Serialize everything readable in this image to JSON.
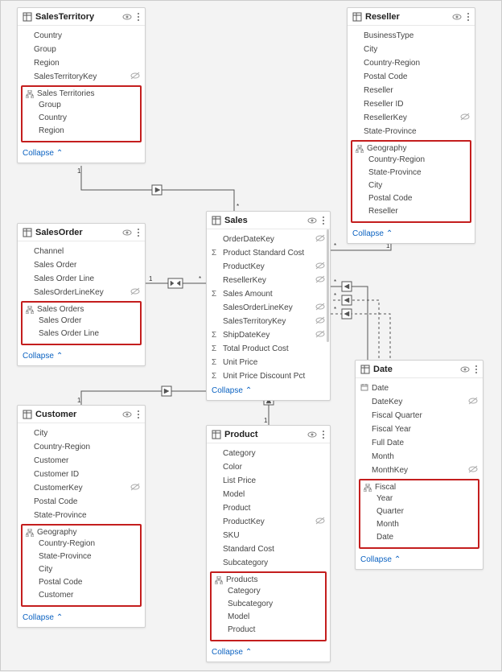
{
  "tables": {
    "salesTerritory": {
      "title": "SalesTerritory",
      "fields": [
        "Country",
        "Group",
        "Region",
        "SalesTerritoryKey"
      ],
      "fieldsHidden": [
        false,
        false,
        false,
        true
      ],
      "hierarchy": {
        "name": "Sales Territories",
        "items": [
          "Group",
          "Country",
          "Region"
        ]
      },
      "collapse": "Collapse"
    },
    "reseller": {
      "title": "Reseller",
      "fields": [
        "BusinessType",
        "City",
        "Country-Region",
        "Postal Code",
        "Reseller",
        "Reseller ID",
        "ResellerKey",
        "State-Province"
      ],
      "fieldsHidden": [
        false,
        false,
        false,
        false,
        false,
        false,
        true,
        false
      ],
      "hierarchy": {
        "name": "Geography",
        "items": [
          "Country-Region",
          "State-Province",
          "City",
          "Postal Code",
          "Reseller"
        ]
      },
      "collapse": "Collapse"
    },
    "salesOrder": {
      "title": "SalesOrder",
      "fields": [
        "Channel",
        "Sales Order",
        "Sales Order Line",
        "SalesOrderLineKey"
      ],
      "fieldsHidden": [
        false,
        false,
        false,
        true
      ],
      "hierarchy": {
        "name": "Sales Orders",
        "items": [
          "Sales Order",
          "Sales Order Line"
        ]
      },
      "collapse": "Collapse"
    },
    "sales": {
      "title": "Sales",
      "fields": [
        "OrderDateKey",
        "Product Standard Cost",
        "ProductKey",
        "ResellerKey",
        "Sales Amount",
        "SalesOrderLineKey",
        "SalesTerritoryKey",
        "ShipDateKey",
        "Total Product Cost",
        "Unit Price",
        "Unit Price Discount Pct"
      ],
      "fieldsIcon": [
        "",
        "sigma",
        "",
        "",
        "sigma",
        "",
        "",
        "sigma",
        "sigma",
        "sigma",
        "sigma"
      ],
      "fieldsHidden": [
        true,
        false,
        true,
        true,
        false,
        true,
        true,
        true,
        false,
        false,
        false
      ],
      "collapse": "Collapse"
    },
    "customer": {
      "title": "Customer",
      "fields": [
        "City",
        "Country-Region",
        "Customer",
        "Customer ID",
        "CustomerKey",
        "Postal Code",
        "State-Province"
      ],
      "fieldsHidden": [
        false,
        false,
        false,
        false,
        true,
        false,
        false
      ],
      "hierarchy": {
        "name": "Geography",
        "items": [
          "Country-Region",
          "State-Province",
          "City",
          "Postal Code",
          "Customer"
        ]
      },
      "collapse": "Collapse"
    },
    "product": {
      "title": "Product",
      "fields": [
        "Category",
        "Color",
        "List Price",
        "Model",
        "Product",
        "ProductKey",
        "SKU",
        "Standard Cost",
        "Subcategory"
      ],
      "fieldsHidden": [
        false,
        false,
        false,
        false,
        false,
        true,
        false,
        false,
        false
      ],
      "hierarchy": {
        "name": "Products",
        "items": [
          "Category",
          "Subcategory",
          "Model",
          "Product"
        ]
      },
      "collapse": "Collapse"
    },
    "date": {
      "title": "Date",
      "fields": [
        "Date",
        "DateKey",
        "Fiscal Quarter",
        "Fiscal Year",
        "Full Date",
        "Month",
        "MonthKey"
      ],
      "fieldsIcon": [
        "cal",
        "",
        "",
        "",
        "",
        "",
        ""
      ],
      "fieldsHidden": [
        false,
        true,
        false,
        false,
        false,
        false,
        true
      ],
      "hierarchy": {
        "name": "Fiscal",
        "items": [
          "Year",
          "Quarter",
          "Month",
          "Date"
        ]
      },
      "collapse": "Collapse"
    }
  }
}
